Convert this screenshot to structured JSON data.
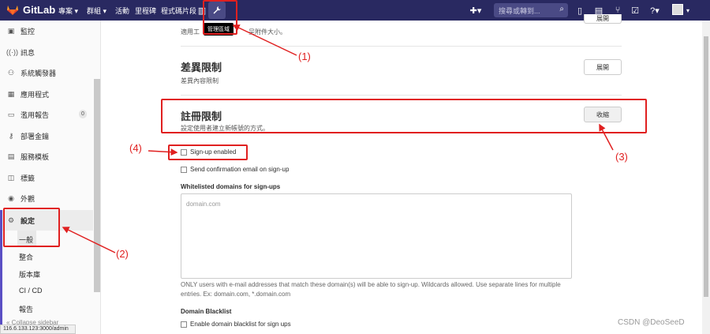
{
  "navbar": {
    "brand": "GitLab",
    "menu": [
      "專案 ▾",
      "群組 ▾",
      "活動",
      "里程碑",
      "程式碼片段"
    ],
    "admin_tooltip": "管理區域",
    "search_placeholder": "搜尋或轉到..."
  },
  "sidebar": {
    "items": [
      {
        "icon": "monitor-icon",
        "label": "監控"
      },
      {
        "icon": "broadcast-icon",
        "label": "訊息"
      },
      {
        "icon": "hook-icon",
        "label": "系統觸發器"
      },
      {
        "icon": "apps-icon",
        "label": "應用程式"
      },
      {
        "icon": "abuse-icon",
        "label": "濫用報告",
        "badge": "0"
      },
      {
        "icon": "key-icon",
        "label": "部署金鑰"
      },
      {
        "icon": "template-icon",
        "label": "服務模板"
      },
      {
        "icon": "label-icon",
        "label": "標籤"
      },
      {
        "icon": "appearance-icon",
        "label": "外觀"
      },
      {
        "icon": "gear-icon",
        "label": "設定"
      }
    ],
    "subitems": [
      "一般",
      "整合",
      "版本庫",
      "CI / CD",
      "報告"
    ],
    "collapse_label": "Collapse sidebar",
    "status_url": "116.6.133.123:3000/admin"
  },
  "sections": {
    "partial_desc": "適用工",
    "partial_desc_tail": "呈附件大小。",
    "diff_title": "差異限制",
    "diff_desc": "差異內容限制",
    "diff_button": "展開",
    "signup_title": "註冊限制",
    "signup_desc": "設定使用者建立新帳號的方式。",
    "signup_button": "收縮",
    "top_button": "展開"
  },
  "form": {
    "signup_enabled": "Sign-up enabled",
    "send_confirmation": "Send confirmation email on sign-up",
    "whitelist_label": "Whitelisted domains for sign-ups",
    "whitelist_placeholder": "domain.com",
    "whitelist_help": "ONLY users with e-mail addresses that match these domain(s) will be able to sign-up. Wildcards allowed. Use separate lines for multiple entries. Ex: domain.com, *.domain.com",
    "blacklist_label": "Domain Blacklist",
    "blacklist_enable": "Enable domain blacklist for sign ups"
  },
  "annotations": [
    "(1)",
    "(2)",
    "(3)",
    "(4)"
  ],
  "watermark": "CSDN @DeoSeeD",
  "colors": {
    "navbar": "#292961",
    "accent": "#e02020",
    "active": "#5a4fc4"
  }
}
